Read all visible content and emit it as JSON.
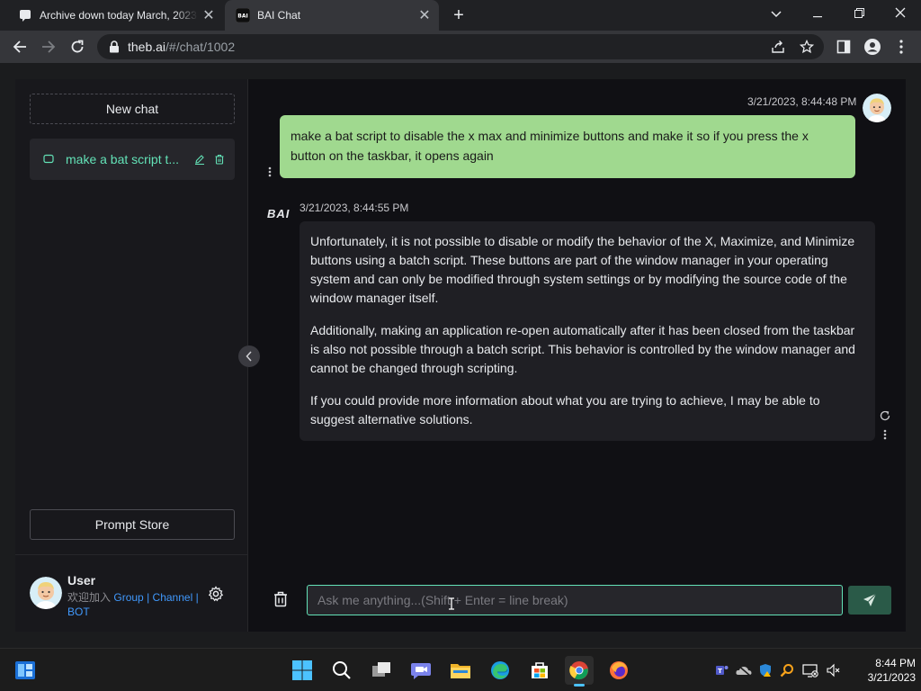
{
  "browser": {
    "tabs": [
      {
        "title": "Archive down today March, 2023"
      },
      {
        "title": "BAI Chat"
      }
    ],
    "new_tab_label": "+",
    "url_host": "theb.ai",
    "url_path": "/#/chat/1002"
  },
  "sidebar": {
    "new_chat_label": "New chat",
    "history": [
      {
        "title": "make a bat script t..."
      }
    ],
    "prompt_store_label": "Prompt Store",
    "user": {
      "name": "User",
      "join_text": "欢迎加入",
      "links": [
        "Group",
        "Channel",
        "BOT"
      ],
      "separator": "|"
    }
  },
  "chat": {
    "messages": [
      {
        "role": "user",
        "time": "3/21/2023, 8:44:48 PM",
        "text": "make a bat script to disable the x max and minimize buttons and make it so if you press the x button on the taskbar, it opens again"
      },
      {
        "role": "bot",
        "logo": "BAI",
        "time": "3/21/2023, 8:44:55 PM",
        "paragraphs": [
          "Unfortunately, it is not possible to disable or modify the behavior of the X, Maximize, and Minimize buttons using a batch script. These buttons are part of the window manager in your operating system and can only be modified through system settings or by modifying the source code of the window manager itself.",
          "Additionally, making an application re-open automatically after it has been closed from the taskbar is also not possible through a batch script. This behavior is controlled by the window manager and cannot be changed through scripting.",
          "If you could provide more information about what you are trying to achieve, I may be able to suggest alternative solutions."
        ]
      }
    ],
    "input_placeholder": "Ask me anything...(Shift + Enter = line break)"
  },
  "taskbar": {
    "time": "8:44 PM",
    "date": "3/21/2023"
  },
  "colors": {
    "accent": "#63e2b7",
    "user_bubble": "#a0d98f",
    "link": "#4098fc",
    "send_button": "#2a5a48"
  }
}
